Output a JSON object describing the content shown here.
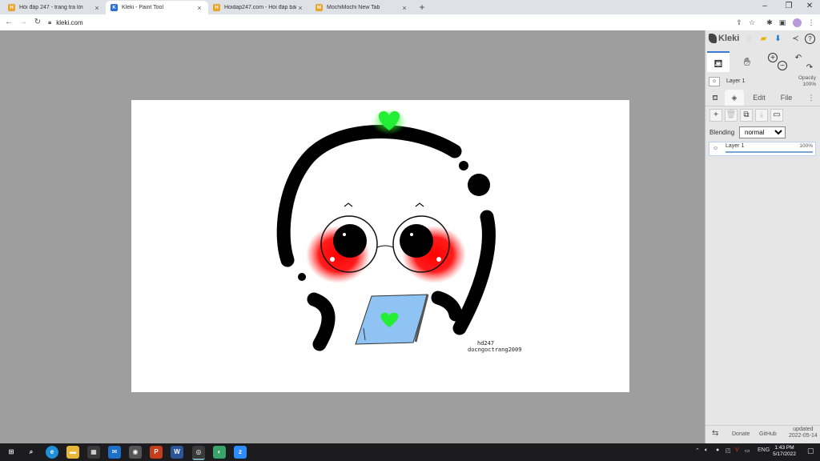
{
  "browser": {
    "tabs": [
      {
        "title": "Hỏi đáp 247 - trang tra lời",
        "favicon": "H",
        "color": "#e8a427",
        "active": false
      },
      {
        "title": "Kleki - Paint Tool",
        "favicon": "K",
        "color": "#2b6cd8",
        "active": true
      },
      {
        "title": "Hoidap247.com - Hỏi đáp bài tập",
        "favicon": "H",
        "color": "#e8a427",
        "active": false
      },
      {
        "title": "MochiMochi New Tab",
        "favicon": "M",
        "color": "#e8a427",
        "active": false
      }
    ],
    "url": "kleki.com"
  },
  "kleki": {
    "logo": "Kleki",
    "layer_name": "Layer 1",
    "opacity_label": "Opacity",
    "opacity_value": "100%",
    "tabs": {
      "edit": "Edit",
      "file": "File"
    },
    "blending_label": "Blending",
    "blending_value": "normal",
    "layer_item": {
      "name": "Layer 1",
      "opacity": "100%"
    },
    "footer": {
      "donate": "Donate",
      "github": "GitHub",
      "updated_label": "updated",
      "updated_date": "2022-05-14"
    }
  },
  "drawing": {
    "signature_line1": "hd247",
    "signature_line2": "docngoctrang2009"
  },
  "taskbar": {
    "language": "ENG",
    "time": "1:43 PM",
    "date": "5/17/2022"
  }
}
